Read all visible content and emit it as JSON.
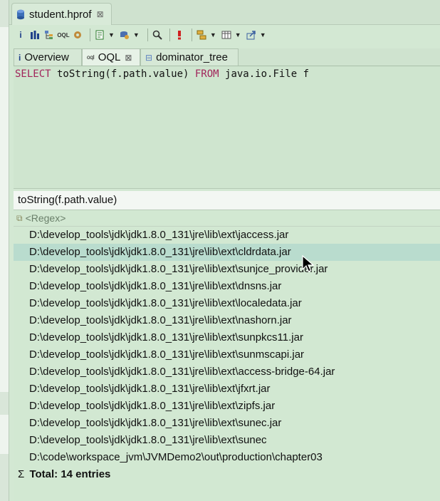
{
  "editor": {
    "tab_title": "student.hprof",
    "tab_close": "⊠"
  },
  "toolbar": {
    "icons": [
      "info-icon",
      "histogram-icon",
      "dominator-tree-icon",
      "oql-icon",
      "settings-icon",
      "report-icon",
      "query-browser-icon",
      "search-icon",
      "leak-suspect-icon",
      "group-by-icon",
      "calculate-icon",
      "export-icon"
    ]
  },
  "view_tabs": [
    {
      "label": "Overview",
      "icon": "i"
    },
    {
      "label": "OQL",
      "icon": "oql",
      "close": "⊠"
    },
    {
      "label": "dominator_tree",
      "icon": "⊟"
    }
  ],
  "query": {
    "kw_select": "SELECT",
    "mid": " toString(f.path.value) ",
    "kw_from": "FROM",
    "tail": " java.io.File f"
  },
  "results": {
    "column_header": "toString(f.path.value)",
    "regex_placeholder": "<Regex>",
    "rows": [
      "D:\\develop_tools\\jdk\\jdk1.8.0_131\\jre\\lib\\ext\\jaccess.jar",
      "D:\\develop_tools\\jdk\\jdk1.8.0_131\\jre\\lib\\ext\\cldrdata.jar",
      "D:\\develop_tools\\jdk\\jdk1.8.0_131\\jre\\lib\\ext\\sunjce_provider.jar",
      "D:\\develop_tools\\jdk\\jdk1.8.0_131\\jre\\lib\\ext\\dnsns.jar",
      "D:\\develop_tools\\jdk\\jdk1.8.0_131\\jre\\lib\\ext\\localedata.jar",
      "D:\\develop_tools\\jdk\\jdk1.8.0_131\\jre\\lib\\ext\\nashorn.jar",
      "D:\\develop_tools\\jdk\\jdk1.8.0_131\\jre\\lib\\ext\\sunpkcs11.jar",
      "D:\\develop_tools\\jdk\\jdk1.8.0_131\\jre\\lib\\ext\\sunmscapi.jar",
      "D:\\develop_tools\\jdk\\jdk1.8.0_131\\jre\\lib\\ext\\access-bridge-64.jar",
      "D:\\develop_tools\\jdk\\jdk1.8.0_131\\jre\\lib\\ext\\jfxrt.jar",
      "D:\\develop_tools\\jdk\\jdk1.8.0_131\\jre\\lib\\ext\\zipfs.jar",
      "D:\\develop_tools\\jdk\\jdk1.8.0_131\\jre\\lib\\ext\\sunec.jar",
      "D:\\develop_tools\\jdk\\jdk1.8.0_131\\jre\\lib\\ext\\sunec",
      "D:\\code\\workspace_jvm\\JVMDemo2\\out\\production\\chapter03"
    ],
    "selected_index": 1,
    "total": "Total: 14 entries",
    "total_symbol": "Σ"
  },
  "colors": {
    "background": "#d3e8d3",
    "selected_row": "#b9dcce",
    "keyword": "#a1245a"
  }
}
